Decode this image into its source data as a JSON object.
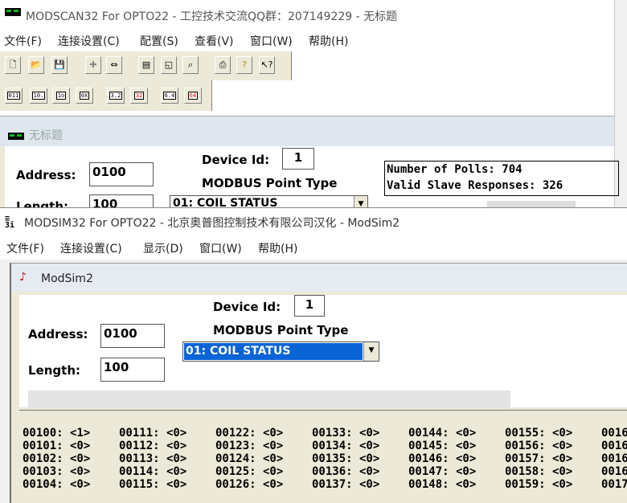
{
  "modscan": {
    "title": "MODSCAN32 For OPTO22 - 工控技术交流QQ群：207149229 - 无标题",
    "menu": [
      "文件(F)",
      "连接设置(C)",
      "配置(S)",
      "查看(V)",
      "窗口(W)",
      "帮助(H)"
    ],
    "toolbar1": [
      "new-icon",
      "open-icon",
      "save-icon",
      "connect-icon",
      "disconnect-icon",
      "display-icon",
      "chart-icon",
      "preview-icon",
      "print-icon",
      "help-icon",
      "context-help-icon"
    ],
    "toolbar2": [
      "011",
      "10.",
      "1o",
      "0X",
      "3.2",
      "32",
      "6.4",
      "64"
    ],
    "child_title": "无标题",
    "device_id_label": "Device Id:",
    "device_id": "1",
    "address_label": "Address:",
    "address": "0100",
    "length_label": "Length:",
    "length": "100",
    "point_type_label": "MODBUS Point Type",
    "point_type": "01: COIL STATUS",
    "polls": "Number of Polls: 704",
    "valid": "Valid Slave Responses: 326"
  },
  "modsim": {
    "title": "MODSIM32 For OPTO22 - 北京奥普图控制技术有限公司汉化 - ModSim2",
    "menu": [
      "文件(F)",
      "连接设置(C)",
      "显示(D)",
      "窗口(W)",
      "帮助(H)"
    ],
    "child_title": "ModSim2",
    "device_id_label": "Device Id:",
    "device_id": "1",
    "address_label": "Address:",
    "address": "0100",
    "length_label": "Length:",
    "length": "100",
    "point_type_label": "MODBUS Point Type",
    "point_type": "01: COIL STATUS",
    "columns": [
      [
        "00100: <1>",
        "00101: <0>",
        "00102: <0>",
        "00103: <0>",
        "00104: <0>"
      ],
      [
        "00111: <0>",
        "00112: <0>",
        "00113: <0>",
        "00114: <0>",
        "00115: <0>"
      ],
      [
        "00122: <0>",
        "00123: <0>",
        "00124: <0>",
        "00125: <0>",
        "00126: <0>"
      ],
      [
        "00133: <0>",
        "00134: <0>",
        "00135: <0>",
        "00136: <0>",
        "00137: <0>"
      ],
      [
        "00144: <0>",
        "00145: <0>",
        "00146: <0>",
        "00147: <0>",
        "00148: <0>"
      ],
      [
        "00155: <0>",
        "00156: <0>",
        "00157: <0>",
        "00158: <0>",
        "00159: <0>"
      ],
      [
        "0016",
        "0016",
        "0016",
        "0016",
        "0017"
      ]
    ]
  }
}
